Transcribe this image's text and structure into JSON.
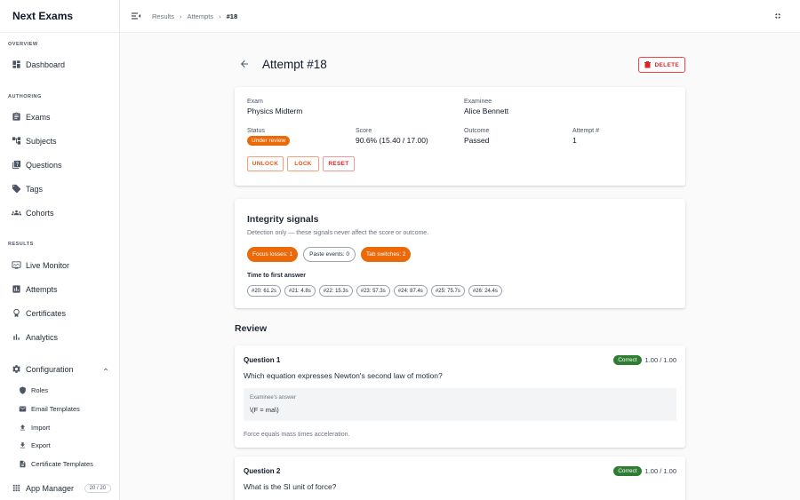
{
  "app": {
    "title": "Next Exams"
  },
  "sidebar": {
    "overview_title": "OVERVIEW",
    "authoring_title": "AUTHORING",
    "results_title": "RESULTS",
    "dashboard": "Dashboard",
    "authoring": [
      "Exams",
      "Subjects",
      "Questions",
      "Tags",
      "Cohorts"
    ],
    "results": [
      "Live Monitor",
      "Attempts",
      "Certificates",
      "Analytics"
    ],
    "configuration": "Configuration",
    "config_items": [
      "Roles",
      "Email Templates",
      "Import",
      "Export",
      "Certificate Templates"
    ],
    "app_manager": "App Manager",
    "app_manager_count": "20 / 20"
  },
  "breadcrumb": {
    "results": "Results",
    "attempts": "Attempts",
    "current": "#18"
  },
  "page": {
    "title": "Attempt #18",
    "delete_label": "DELETE"
  },
  "attempt": {
    "exam_label": "Exam",
    "exam": "Physics Midterm",
    "examinee_label": "Examinee",
    "examinee": "Alice Bennett",
    "status_label": "Status",
    "status": "Under review",
    "score_label": "Score",
    "score": "90.6% (15.40 / 17.00)",
    "outcome_label": "Outcome",
    "outcome": "Passed",
    "attempt_no_label": "Attempt #",
    "attempt_no": "1",
    "actions": {
      "unlock": "UNLOCK",
      "lock": "LOCK",
      "reset": "RESET"
    }
  },
  "integrity": {
    "title": "Integrity signals",
    "subtitle": "Detection only — these signals never affect the score or outcome.",
    "focus_losses": "Focus losses: 1",
    "paste_events": "Paste events: 0",
    "tab_switches": "Tab switches: 2",
    "tfa_title": "Time to first answer",
    "tfa": [
      "#20: 61.2s",
      "#21: 4.8s",
      "#22: 15.3s",
      "#23: 57.3s",
      "#24: 87.4s",
      "#25: 75.7s",
      "#26: 24.4s"
    ]
  },
  "review": {
    "title": "Review",
    "questions": [
      {
        "title": "Question 1",
        "status": "Correct",
        "score": "1.00 / 1.00",
        "text": "Which equation expresses Newton's second law of motion?",
        "answer_label": "Examinee's answer",
        "answer": "\\(F = ma\\)",
        "explanation": "Force equals mass times acceleration."
      },
      {
        "title": "Question 2",
        "status": "Correct",
        "score": "1.00 / 1.00",
        "text": "What is the SI unit of force?"
      }
    ]
  },
  "colors": {
    "accent": "#ea6a0a",
    "success": "#2e7d32",
    "danger": "#dc2626"
  }
}
